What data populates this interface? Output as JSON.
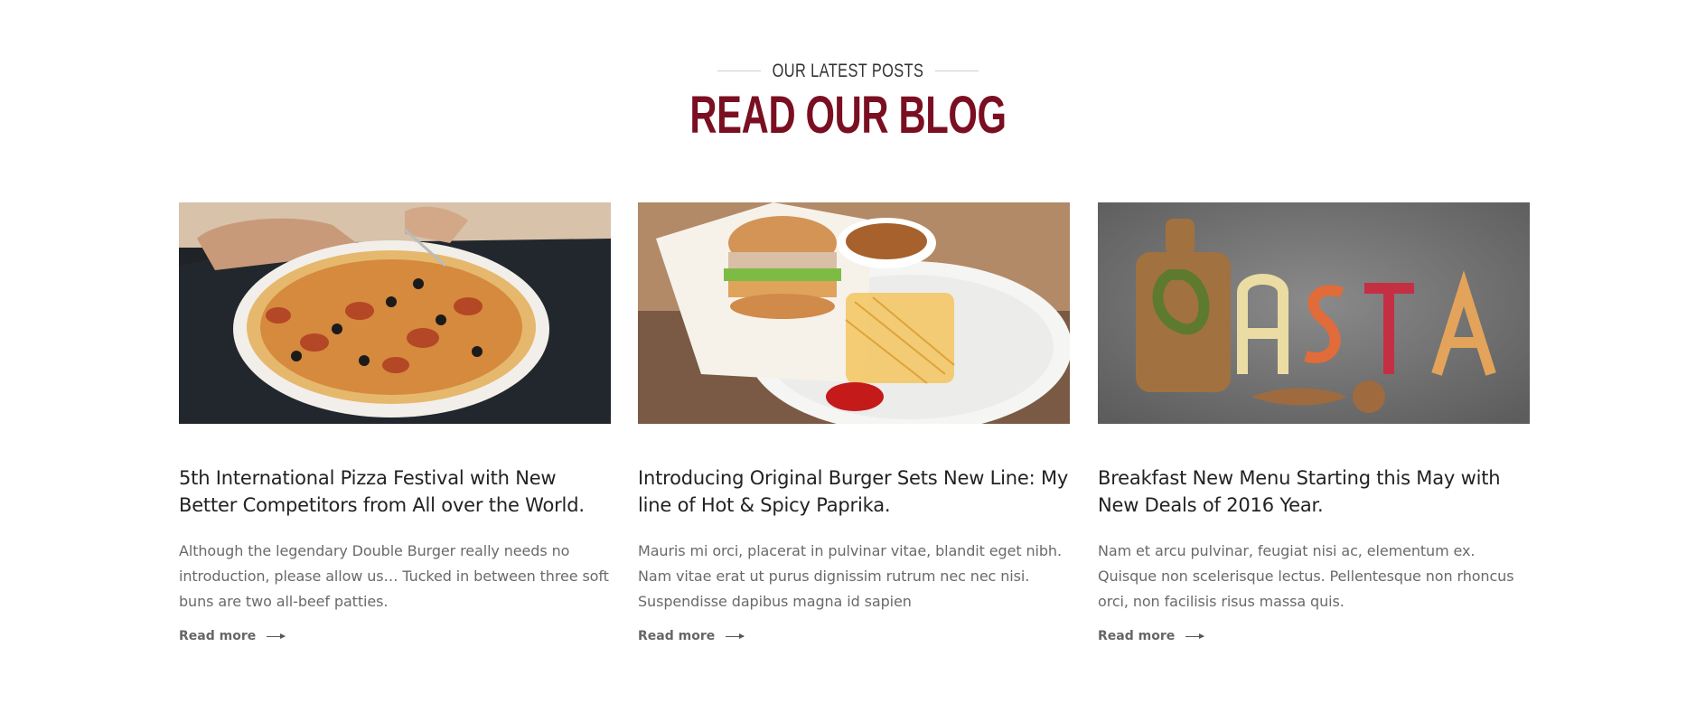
{
  "section": {
    "eyebrow": "OUR LATEST POSTS",
    "title": "READ OUR BLOG"
  },
  "posts": [
    {
      "image_name": "pizza-photo",
      "title": "5th International Pizza Festival with New Better Competitors from All over the World.",
      "excerpt": "Although the legendary Double Burger really needs no introduction, please allow us… Tucked in between three soft buns are two all-beef patties.",
      "read_more": "Read more"
    },
    {
      "image_name": "burger-photo",
      "title": "Introducing Original Burger Sets New Line: My line of Hot & Spicy Paprika.",
      "excerpt": "Mauris mi orci, placerat in pulvinar vitae, blandit eget nibh. Nam vitae erat ut purus dignissim rutrum nec nec nisi. Suspendisse dapibus magna id sapien",
      "read_more": "Read more"
    },
    {
      "image_name": "pasta-photo",
      "title": "Breakfast New Menu Starting this May with New Deals of 2016 Year.",
      "excerpt": "Nam et arcu pulvinar, feugiat nisi ac, elementum ex. Quisque non scelerisque lectus. Pellentesque non rhoncus orci, non facilisis risus massa quis.",
      "read_more": "Read more"
    }
  ],
  "colors": {
    "accent": "#7b0f22",
    "text": "#222222",
    "muted": "#6a6a6a"
  }
}
